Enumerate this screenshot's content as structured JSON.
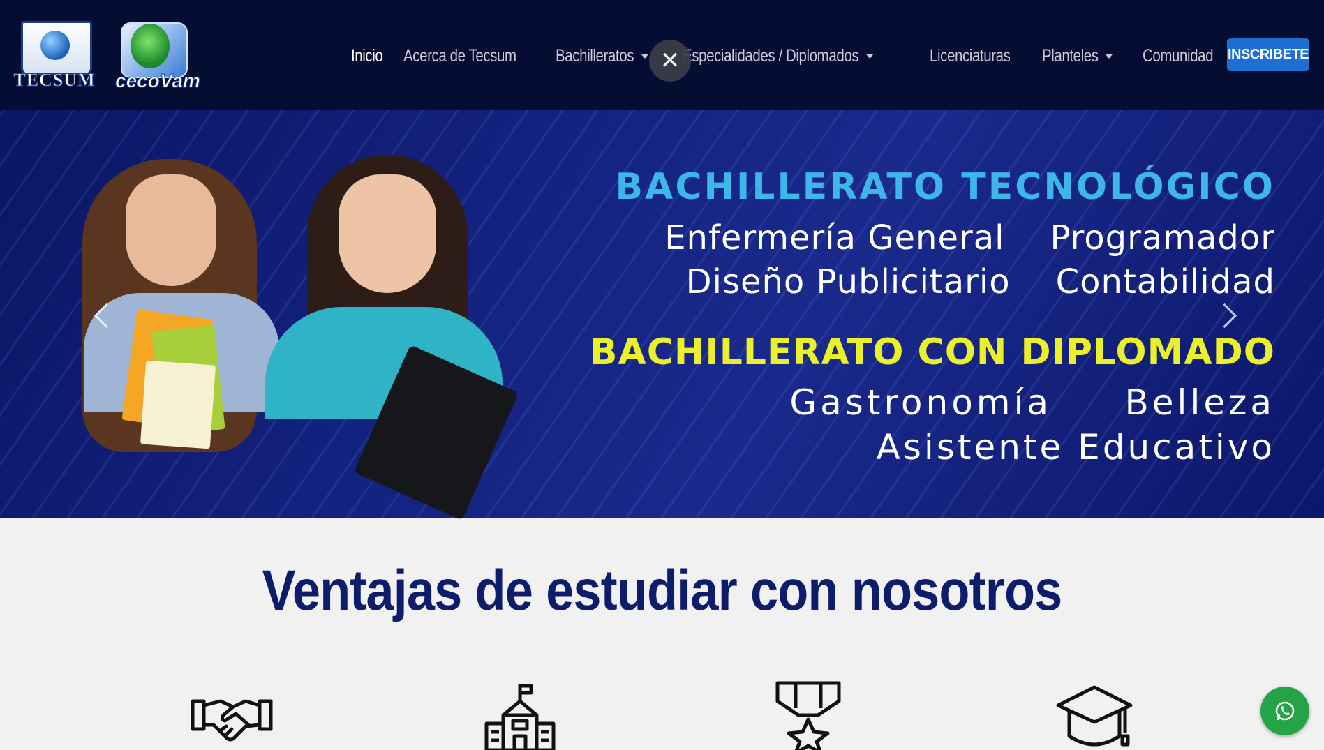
{
  "brand": {
    "logo1_text": "TECSUM",
    "logo2_text": "cecoVam"
  },
  "nav": {
    "items": [
      {
        "label": "Inicio",
        "active": true,
        "dropdown": false
      },
      {
        "label": "Acerca de Tecsum",
        "active": false,
        "dropdown": false
      },
      {
        "label": "Bachilleratos",
        "active": false,
        "dropdown": true
      },
      {
        "label": "Especialidades / Diplomados",
        "active": false,
        "dropdown": true
      },
      {
        "label": "Licenciaturas",
        "active": false,
        "dropdown": false
      },
      {
        "label": "Planteles",
        "active": false,
        "dropdown": true
      },
      {
        "label": "Comunidad",
        "active": false,
        "dropdown": false
      }
    ],
    "cta_label": "INSCRIBETE",
    "close_glyph": "✕"
  },
  "hero": {
    "line1": "BACHILLERATO TECNOLÓGICO",
    "line2": "Enfermería General    Programador",
    "line3": "Diseño Publicitario    Contabilidad",
    "line4": "BACHILLERATO CON DIPLOMADO",
    "line5": "Gastronomía     Belleza",
    "line6": "Asistente Educativo"
  },
  "section": {
    "title": "Ventajas de estudiar con nosotros"
  },
  "icons": {
    "feature1": "handshake-icon",
    "feature2": "school-building-icon",
    "feature3": "medal-star-icon",
    "feature4": "graduation-cap-icon",
    "whatsapp": "whatsapp-icon"
  },
  "colors": {
    "nav_bg": "#050d33",
    "cta_bg": "#1d6fd1",
    "hero_cyan": "#3fb6e9",
    "hero_yellow": "#eaf02a",
    "title_navy": "#0d1d6b",
    "whatsapp_green": "#25a347"
  }
}
